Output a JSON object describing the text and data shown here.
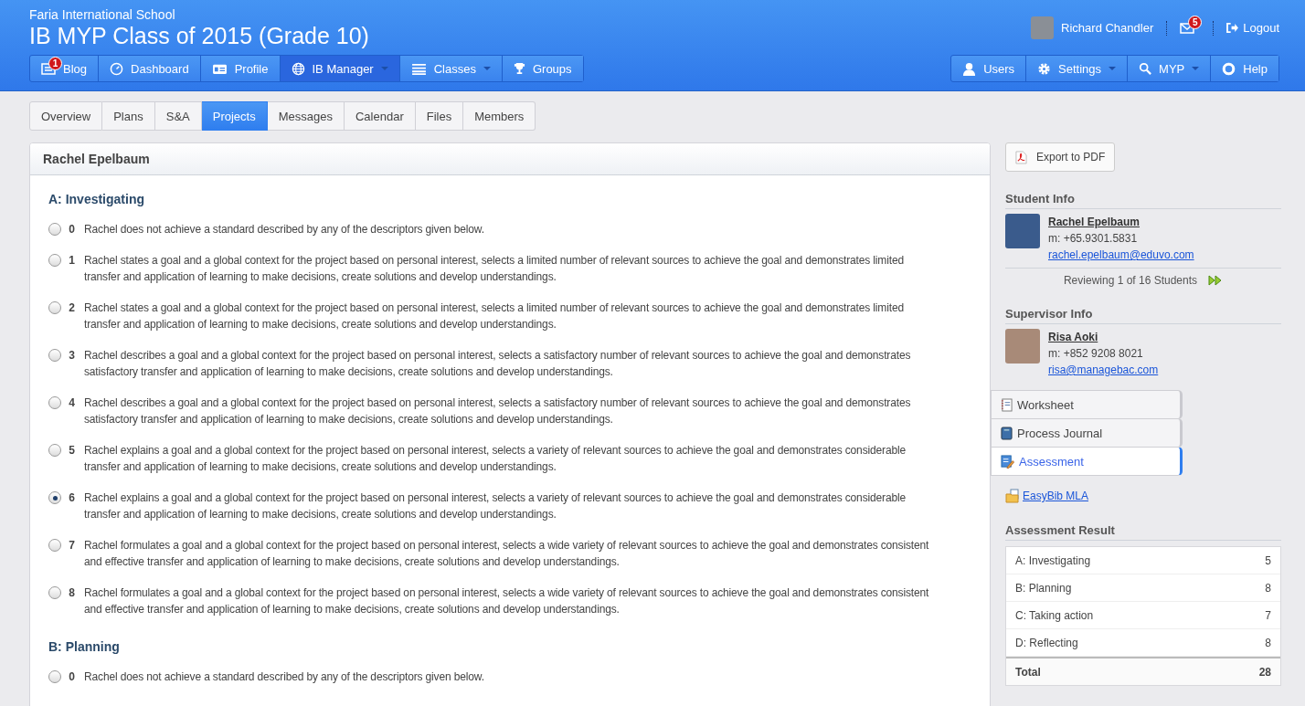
{
  "header": {
    "school": "Faria International School",
    "title": "IB MYP Class of 2015 (Grade 10)",
    "user": {
      "name": "Richard Chandler",
      "mail_badge": "5",
      "logout": "Logout"
    },
    "nav_left": [
      {
        "label": "Blog",
        "badge": "1",
        "dropdown": false,
        "selected": false
      },
      {
        "label": "Dashboard",
        "dropdown": false,
        "selected": false
      },
      {
        "label": "Profile",
        "dropdown": false,
        "selected": false
      },
      {
        "label": "IB Manager",
        "dropdown": true,
        "selected": true
      },
      {
        "label": "Classes",
        "dropdown": true,
        "selected": false
      },
      {
        "label": "Groups",
        "dropdown": false,
        "selected": false
      }
    ],
    "nav_right": [
      {
        "label": "Users",
        "dropdown": false
      },
      {
        "label": "Settings",
        "dropdown": true
      },
      {
        "label": "MYP",
        "dropdown": true
      },
      {
        "label": "Help",
        "dropdown": false
      }
    ]
  },
  "tabs": [
    {
      "label": "Overview",
      "selected": false
    },
    {
      "label": "Plans",
      "selected": false
    },
    {
      "label": "S&A",
      "selected": false
    },
    {
      "label": "Projects",
      "selected": true
    },
    {
      "label": "Messages",
      "selected": false
    },
    {
      "label": "Calendar",
      "selected": false
    },
    {
      "label": "Files",
      "selected": false
    },
    {
      "label": "Members",
      "selected": false
    }
  ],
  "panel": {
    "title": "Rachel Epelbaum",
    "criteria": [
      {
        "heading": "A: Investigating",
        "levels": [
          {
            "score": "0",
            "text": "Rachel does not achieve a standard described by any of the descriptors given below.",
            "selected": false
          },
          {
            "score": "1",
            "text": "Rachel states a goal and a global context for the project based on personal interest, selects a limited number of relevant sources to achieve the goal and demonstrates limited transfer and application of learning to make decisions, create solutions and develop understandings.",
            "selected": false
          },
          {
            "score": "2",
            "text": "Rachel states a goal and a global context for the project based on personal interest, selects a limited number of relevant sources to achieve the goal and demonstrates limited transfer and application of learning to make decisions, create solutions and develop understandings.",
            "selected": false
          },
          {
            "score": "3",
            "text": "Rachel describes a goal and a global context for the project based on personal interest, selects a satisfactory number of relevant sources to achieve the goal and demonstrates satisfactory transfer and application of learning to make decisions, create solutions and develop understandings.",
            "selected": false
          },
          {
            "score": "4",
            "text": "Rachel describes a goal and a global context for the project based on personal interest, selects a satisfactory number of relevant sources to achieve the goal and demonstrates satisfactory transfer and application of learning to make decisions, create solutions and develop understandings.",
            "selected": false
          },
          {
            "score": "5",
            "text": "Rachel explains a goal and a global context for the project based on personal interest, selects a variety of relevant sources to achieve the goal and demonstrates considerable transfer and application of learning to make decisions, create solutions and develop understandings.",
            "selected": false
          },
          {
            "score": "6",
            "text": "Rachel explains a goal and a global context for the project based on personal interest, selects a variety of relevant sources to achieve the goal and demonstrates considerable transfer and application of learning to make decisions, create solutions and develop understandings.",
            "selected": true
          },
          {
            "score": "7",
            "text": "Rachel formulates a goal and a global context for the project based on personal interest, selects a wide variety of relevant sources to achieve the goal and demonstrates consistent and effective transfer and application of learning to make decisions, create solutions and develop understandings.",
            "selected": false
          },
          {
            "score": "8",
            "text": "Rachel formulates a goal and a global context for the project based on personal interest, selects a wide variety of relevant sources to achieve the goal and demonstrates consistent and effective transfer and application of learning to make decisions, create solutions and develop understandings.",
            "selected": false
          }
        ]
      },
      {
        "heading": "B: Planning",
        "levels": [
          {
            "score": "0",
            "text": "Rachel does not achieve a standard described by any of the descriptors given below.",
            "selected": false
          }
        ]
      }
    ]
  },
  "sidebar": {
    "export_button": "Export to PDF",
    "student_info": {
      "heading": "Student Info",
      "name": "Rachel Epelbaum",
      "phone": "m: +65.9301.5831",
      "email": "rachel.epelbaum@eduvo.com",
      "reviewing": "Reviewing 1 of 16 Students"
    },
    "supervisor_info": {
      "heading": "Supervisor Info",
      "name": "Risa Aoki",
      "phone": "m: +852 9208 8021",
      "email": "risa@managebac.com"
    },
    "tabs": [
      {
        "label": "Worksheet",
        "selected": false
      },
      {
        "label": "Process Journal",
        "selected": false
      },
      {
        "label": "Assessment",
        "selected": true
      }
    ],
    "link": "EasyBib MLA",
    "result": {
      "heading": "Assessment Result",
      "rows": [
        {
          "label": "A: Investigating",
          "value": "5"
        },
        {
          "label": "B: Planning",
          "value": "8"
        },
        {
          "label": "C: Taking action",
          "value": "7"
        },
        {
          "label": "D: Reflecting",
          "value": "8"
        }
      ],
      "total_label": "Total",
      "total_value": "28"
    }
  }
}
